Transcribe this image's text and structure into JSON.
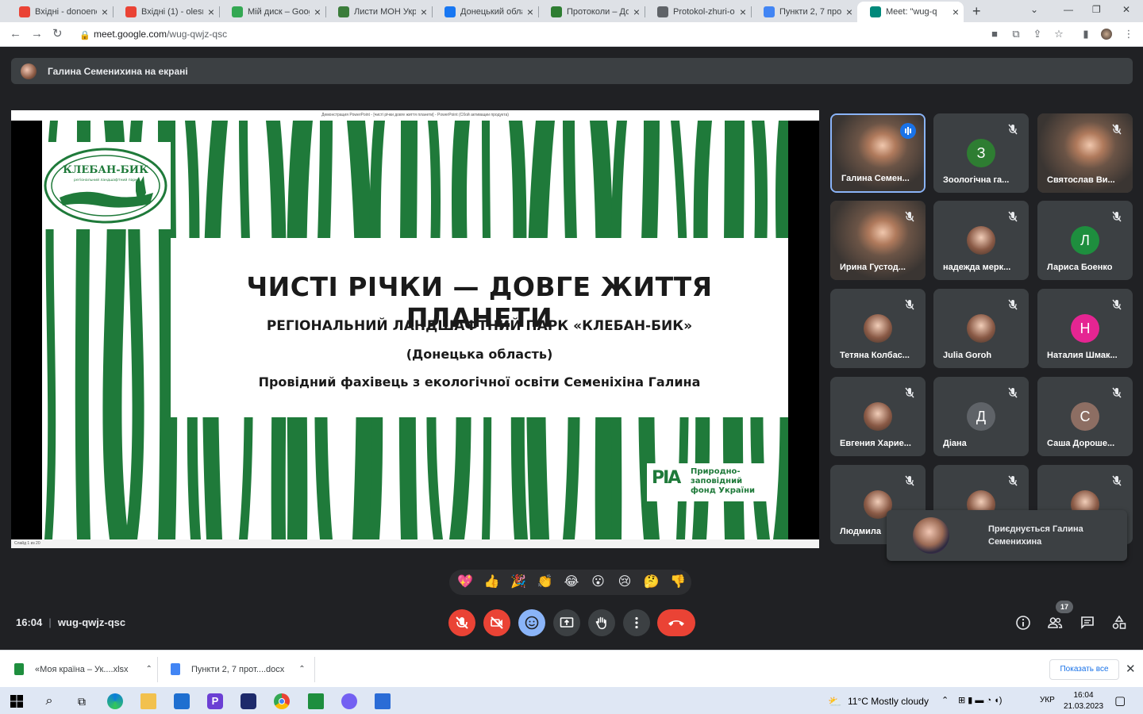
{
  "browser": {
    "tabs": [
      {
        "title": "Вхідні - donoenc",
        "color": "#ea4335"
      },
      {
        "title": "Вхідні (1) - olesne",
        "color": "#ea4335"
      },
      {
        "title": "Мій диск – Google",
        "color": "#34a853"
      },
      {
        "title": "Листи МОН Укра",
        "color": "#3b7d3b"
      },
      {
        "title": "Донецький обла",
        "color": "#1877f2"
      },
      {
        "title": "Протоколи – До",
        "color": "#2e7d32"
      },
      {
        "title": "Protokol-zhuri-ol",
        "color": "#5f6368"
      },
      {
        "title": "Пункти 2, 7 прот",
        "color": "#4285f4"
      },
      {
        "title": "Meet: \"wug-q",
        "color": "#00897b"
      }
    ],
    "url_host": "meet.google.com",
    "url_path": "/wug-qwjz-qsc"
  },
  "banner": {
    "text": "Галина Семенихина на екрані"
  },
  "presentation": {
    "window_title": "Демонстрация PowerPoint - [чисті річки довге життя планети] - PowerPoint (Сбой активации продукта)",
    "status": "Слайд 1 из 20",
    "logo_text": "КЛЕБАН-БИК",
    "logo_sub": "регіональний ландшафтний парк",
    "title": "ЧИСТІ РІЧКИ — ДОВГЕ ЖИТТЯ ПЛАНЕТИ",
    "subtitle": "РЕГІОНАЛЬНИЙ ЛАНДШАФТНИЙ ПАРК «КЛЕБАН-БИК»",
    "region": "(Донецька область)",
    "author": "Провідний фахівець з екологічної освіти Семеніхіна Галина",
    "fund_logo": "PIA",
    "fund_line1": "Природно-",
    "fund_line2": "заповідний",
    "fund_line3": "фонд України",
    "accent": "#1f7a3a"
  },
  "participants": [
    {
      "name": "Галина Семен...",
      "type": "video",
      "speaking": true
    },
    {
      "name": "Зоологічна га...",
      "type": "letter",
      "letter": "З",
      "color": "#2e7d32"
    },
    {
      "name": "Святослав Ви...",
      "type": "video"
    },
    {
      "name": "Ирина Густод...",
      "type": "video"
    },
    {
      "name": "надежда мерк...",
      "type": "photo"
    },
    {
      "name": "Лариса Боенко",
      "type": "letter",
      "letter": "Л",
      "color": "#1e8e3e"
    },
    {
      "name": "Тетяна Колбас...",
      "type": "photo"
    },
    {
      "name": "Julia Goroh",
      "type": "photo"
    },
    {
      "name": "Наталия Шмак...",
      "type": "letter",
      "letter": "Н",
      "color": "#e52592"
    },
    {
      "name": "Евгения Харие...",
      "type": "photo"
    },
    {
      "name": "Діана",
      "type": "letter",
      "letter": "Д",
      "color": "#5f6368"
    },
    {
      "name": "Саша Дороше...",
      "type": "letter",
      "letter": "С",
      "color": "#8d6e63"
    },
    {
      "name": "Людмила",
      "type": "photo"
    },
    {
      "name": "",
      "type": "photo"
    },
    {
      "name": "",
      "type": "photo"
    }
  ],
  "toast": {
    "text": "Приєднується Галина Семенихина"
  },
  "reactions": [
    "💖",
    "👍",
    "🎉",
    "👏",
    "😂",
    "😮",
    "😢",
    "🤔",
    "👎"
  ],
  "meeting": {
    "time": "16:04",
    "code": "wug-qwjz-qsc",
    "participant_count": "17"
  },
  "downloads": {
    "items": [
      {
        "name": "«Моя країна – Ук....xlsx",
        "color": "#1e8e3e"
      },
      {
        "name": "Пункти 2, 7 прот....docx",
        "color": "#4285f4"
      }
    ],
    "show_all": "Показать все"
  },
  "taskbar": {
    "weather": "11°C  Mostly cloudy",
    "lang": "УКР",
    "time": "16:04",
    "date": "21.03.2023"
  }
}
